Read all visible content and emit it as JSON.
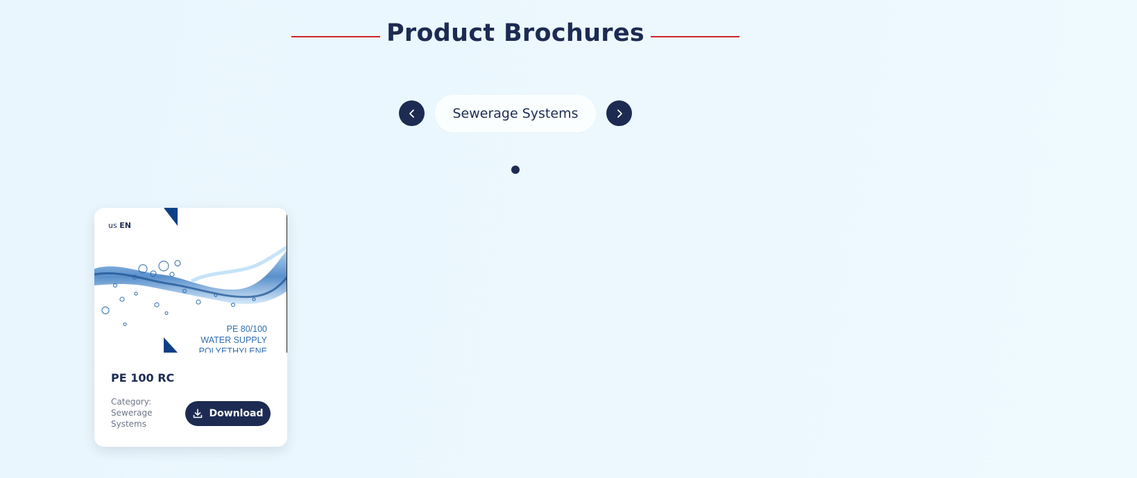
{
  "section": {
    "title": "Product Brochures"
  },
  "carousel": {
    "current_category": "Sewerage Systems",
    "prev_icon": "chevron-left-icon",
    "next_icon": "chevron-right-icon",
    "page_count": 1,
    "active_page": 1
  },
  "cards": [
    {
      "title": "PE 100 RC",
      "category_label": "Category:",
      "category_value": "Sewerage Systems",
      "download_label": "Download",
      "download_icon": "download-icon",
      "thumbnail": {
        "lang_flag": "us",
        "lang_code": "EN",
        "line1": "PE 80/100",
        "line2": "WATER SUPPLY",
        "line3": "POLYETHYLENE"
      }
    }
  ],
  "colors": {
    "navy": "#1d2b53",
    "accent_red": "#d3232a",
    "background": "#ecf8fe"
  }
}
